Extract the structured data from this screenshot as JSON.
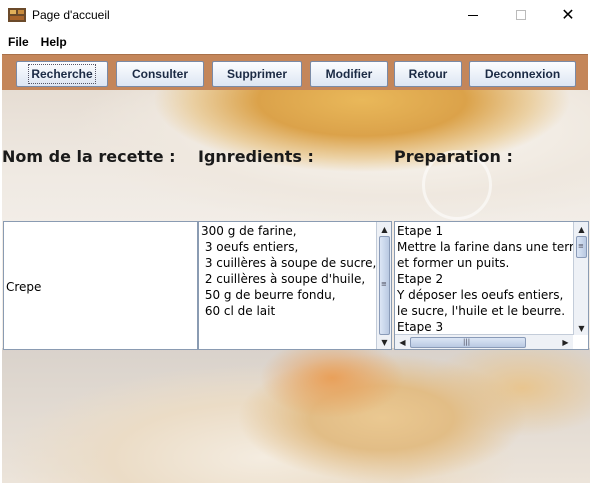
{
  "window": {
    "title": "Page d'accueil",
    "close_glyph": "✕"
  },
  "menu": {
    "items": [
      "File",
      "Help"
    ]
  },
  "toolbar": {
    "buttons": [
      "Recherche",
      "Consulter",
      "Supprimer",
      "Modifier",
      "Retour",
      "Deconnexion"
    ],
    "background_color": "#c4865a"
  },
  "headers": {
    "name": "Nom de la recette :",
    "ingredients": "Ignredients :",
    "preparation": "Preparation :"
  },
  "recipe": {
    "name": "Crepe",
    "ingredients": "300 g de farine,\n 3 oeufs entiers,\n 3 cuillères à soupe de sucre,\n 2 cuillères à soupe d'huile,\n 50 g de beurre fondu,\n 60 cl de lait",
    "preparation": "Etape 1\nMettre la farine dans une terrine\net former un puits.\nEtape 2\nY déposer les oeufs entiers,\nle sucre, l'huile et le beurre.\nEtape 3"
  },
  "icons": {
    "app": "app-icon",
    "scroll_up": "▲",
    "scroll_down": "▼",
    "scroll_left": "◀",
    "scroll_right": "▶",
    "grip_v": "≡",
    "grip_h": "|||"
  }
}
